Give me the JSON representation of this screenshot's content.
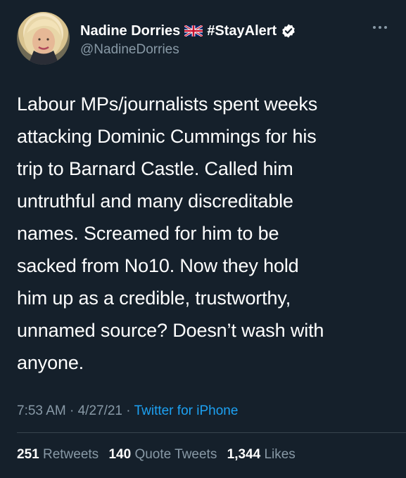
{
  "author": {
    "display_name": "Nadine Dorries",
    "hashtag": "#StayAlert",
    "handle": "@NadineDorries"
  },
  "icons": {
    "avatar": "profile-photo",
    "flag": "uk-flag-icon",
    "verified": "verified-badge-icon",
    "more": "more-options-icon"
  },
  "tweet": {
    "text": "Labour MPs/journalists spent weeks\nattacking Dominic Cummings for his\ntrip to Barnard Castle. Called him\nuntruthful and many discreditable\nnames. Screamed for him to be\nsacked from No10.   Now they hold\nhim up as a credible, trustworthy,\nunnamed source? Doesn’t wash with\nanyone."
  },
  "meta": {
    "time": "7:53 AM",
    "separator": "·",
    "date": "4/27/21",
    "source": "Twitter for iPhone"
  },
  "stats": {
    "retweets_count": "251",
    "retweets_label": "Retweets",
    "quotes_count": "140",
    "quotes_label": "Quote Tweets",
    "likes_count": "1,344",
    "likes_label": "Likes"
  },
  "colors": {
    "background": "#15202b",
    "secondary_text": "#8899a6",
    "link": "#1da1f2",
    "divider": "#38444d"
  }
}
